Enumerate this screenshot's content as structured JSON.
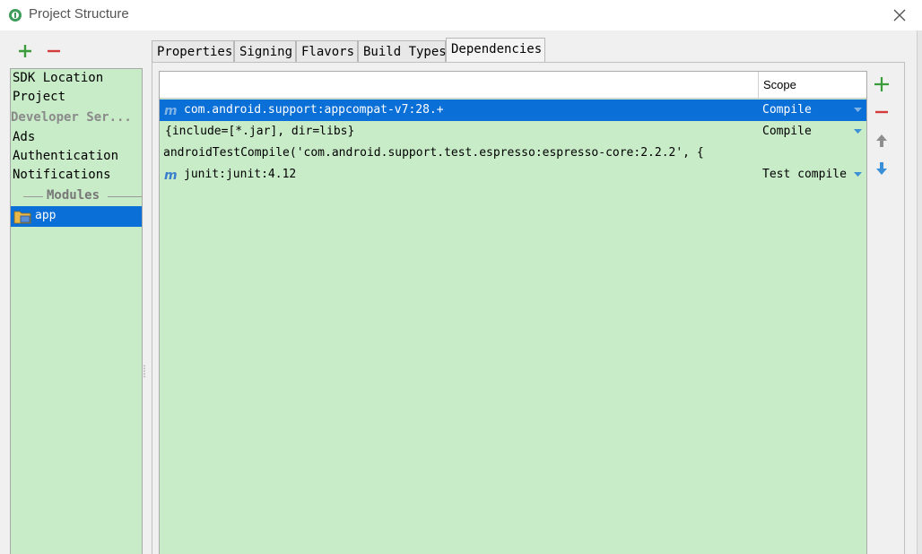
{
  "window": {
    "title": "Project Structure"
  },
  "sidebar": {
    "items": [
      {
        "label": "SDK Location"
      },
      {
        "label": "Project"
      }
    ],
    "developer_services_header": "Developer Ser...",
    "service_items": [
      {
        "label": "Ads"
      },
      {
        "label": "Authentication"
      },
      {
        "label": "Notifications"
      }
    ],
    "modules_label": "Modules",
    "modules": [
      {
        "label": "app",
        "selected": true
      }
    ]
  },
  "tabs": [
    {
      "label": "Properties"
    },
    {
      "label": "Signing"
    },
    {
      "label": "Flavors"
    },
    {
      "label": "Build Types"
    },
    {
      "label": "Dependencies",
      "active": true
    }
  ],
  "dependencies": {
    "scope_header": "Scope",
    "rows": [
      {
        "name": "com.android.support:appcompat-v7:28.+",
        "scope": "Compile",
        "icon": "maven-icon",
        "selected": true
      },
      {
        "name": "{include=[*.jar], dir=libs}",
        "scope": "Compile",
        "icon": ""
      },
      {
        "name": "androidTestCompile('com.android.support.test.espresso:espresso-core:2.2.2', {",
        "scope": "",
        "icon": ""
      },
      {
        "name": "junit:junit:4.12",
        "scope": "Test compile",
        "icon": "maven-icon"
      }
    ]
  },
  "colors": {
    "panel_green": "#c8ebc8",
    "selection_blue": "#0a6fd6",
    "add_green": "#3a9c3a",
    "remove_red": "#d43a3a",
    "arrow_gray": "#8e8e8e",
    "arrow_blue": "#3a8fd6"
  }
}
